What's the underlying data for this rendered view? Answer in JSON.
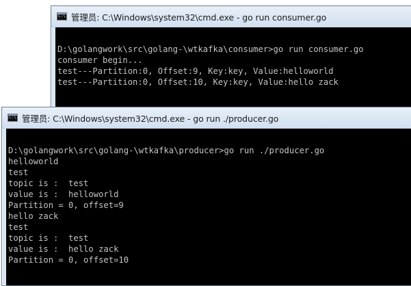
{
  "consumer_window": {
    "title": "管理员: C:\\Windows\\system32\\cmd.exe - go  run consumer.go",
    "icon": "cmd-icon",
    "lines": [
      "",
      "D:\\golangwork\\src\\golang-\\wtkafka\\consumer>go run consumer.go",
      "consumer begin...",
      "test---Partition:0, Offset:9, Key:key, Value:helloworld",
      "test---Partition:0, Offset:10, Key:key, Value:hello zack"
    ]
  },
  "producer_window": {
    "title": "管理员: C:\\Windows\\system32\\cmd.exe - go  run ./producer.go",
    "icon": "cmd-icon",
    "lines": [
      "",
      "D:\\golangwork\\src\\golang-\\wtkafka\\producer>go run ./producer.go",
      "helloworld",
      "test",
      "topic is :  test",
      "value is :  helloworld",
      "Partition = 0, offset=9",
      "hello zack",
      "test",
      "topic is :  test",
      "value is :  hello zack",
      "Partition = 0, offset=10"
    ]
  },
  "colors": {
    "console_background": "#000000",
    "console_text": "#c4c4c4",
    "titlebar": "#dce7f4"
  }
}
